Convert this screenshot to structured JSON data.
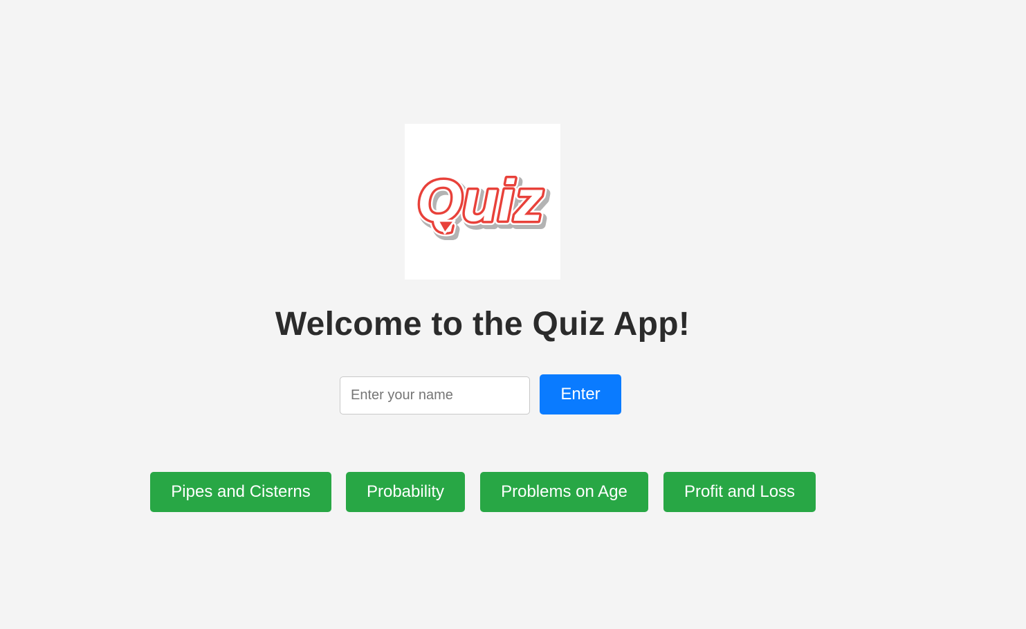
{
  "logo": {
    "text": "Quiz",
    "icon": "quiz-logo",
    "colors": {
      "fill": "#e8413a",
      "outline": "#ffffff",
      "shadow": "#9a9a9a"
    }
  },
  "welcome": {
    "title": "Welcome to the Quiz App!"
  },
  "name_form": {
    "input_value": "",
    "placeholder": "Enter your name",
    "submit_label": "Enter",
    "submit_color": "#0a7bff"
  },
  "topics": {
    "button_color": "#28a745",
    "items": [
      {
        "label": "Pipes and Cisterns"
      },
      {
        "label": "Probability"
      },
      {
        "label": "Problems on Age"
      },
      {
        "label": "Profit and Loss"
      }
    ]
  }
}
